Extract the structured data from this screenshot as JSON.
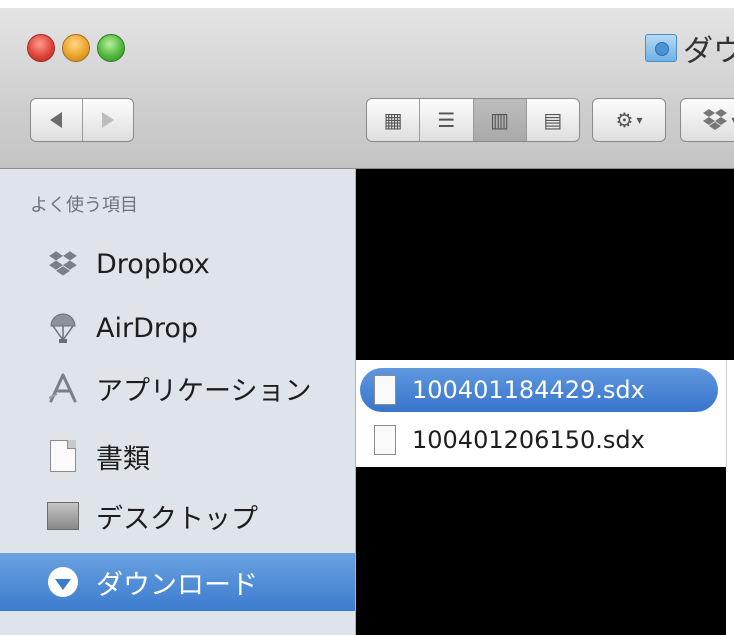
{
  "window": {
    "title": "ダウンロード",
    "title_visible": "ダウ"
  },
  "toolbar": {
    "traffic_lights": [
      "close",
      "minimize",
      "zoom"
    ],
    "nav": {
      "back_icon": "back-arrow-icon",
      "forward_icon": "forward-arrow-icon"
    },
    "view_modes": [
      {
        "icon": "icon-view-icon",
        "glyph": "▦",
        "active": false
      },
      {
        "icon": "list-view-icon",
        "glyph": "☰",
        "active": false
      },
      {
        "icon": "column-view-icon",
        "glyph": "▥",
        "active": true
      },
      {
        "icon": "coverflow-view-icon",
        "glyph": "▤",
        "active": false
      }
    ],
    "action_icon": "gear-icon",
    "dropbox_icon": "dropbox-icon"
  },
  "sidebar": {
    "header": "よく使う項目",
    "items": [
      {
        "label": "Dropbox",
        "icon": "dropbox-icon",
        "selected": false
      },
      {
        "label": "AirDrop",
        "icon": "airdrop-icon",
        "selected": false
      },
      {
        "label": "アプリケーション",
        "icon": "applications-icon",
        "selected": false
      },
      {
        "label": "書類",
        "icon": "documents-icon",
        "selected": false
      },
      {
        "label": "デスクトップ",
        "icon": "desktop-icon",
        "selected": false
      },
      {
        "label": "ダウンロード",
        "icon": "downloads-icon",
        "selected": true
      }
    ]
  },
  "files": [
    {
      "name": "100401184429.sdx",
      "selected": true
    },
    {
      "name": "100401206150.sdx",
      "selected": false
    }
  ],
  "colors": {
    "selection": "#3c7ccf",
    "sidebar_bg": "#dfe4ea",
    "redaction": "#000000"
  }
}
